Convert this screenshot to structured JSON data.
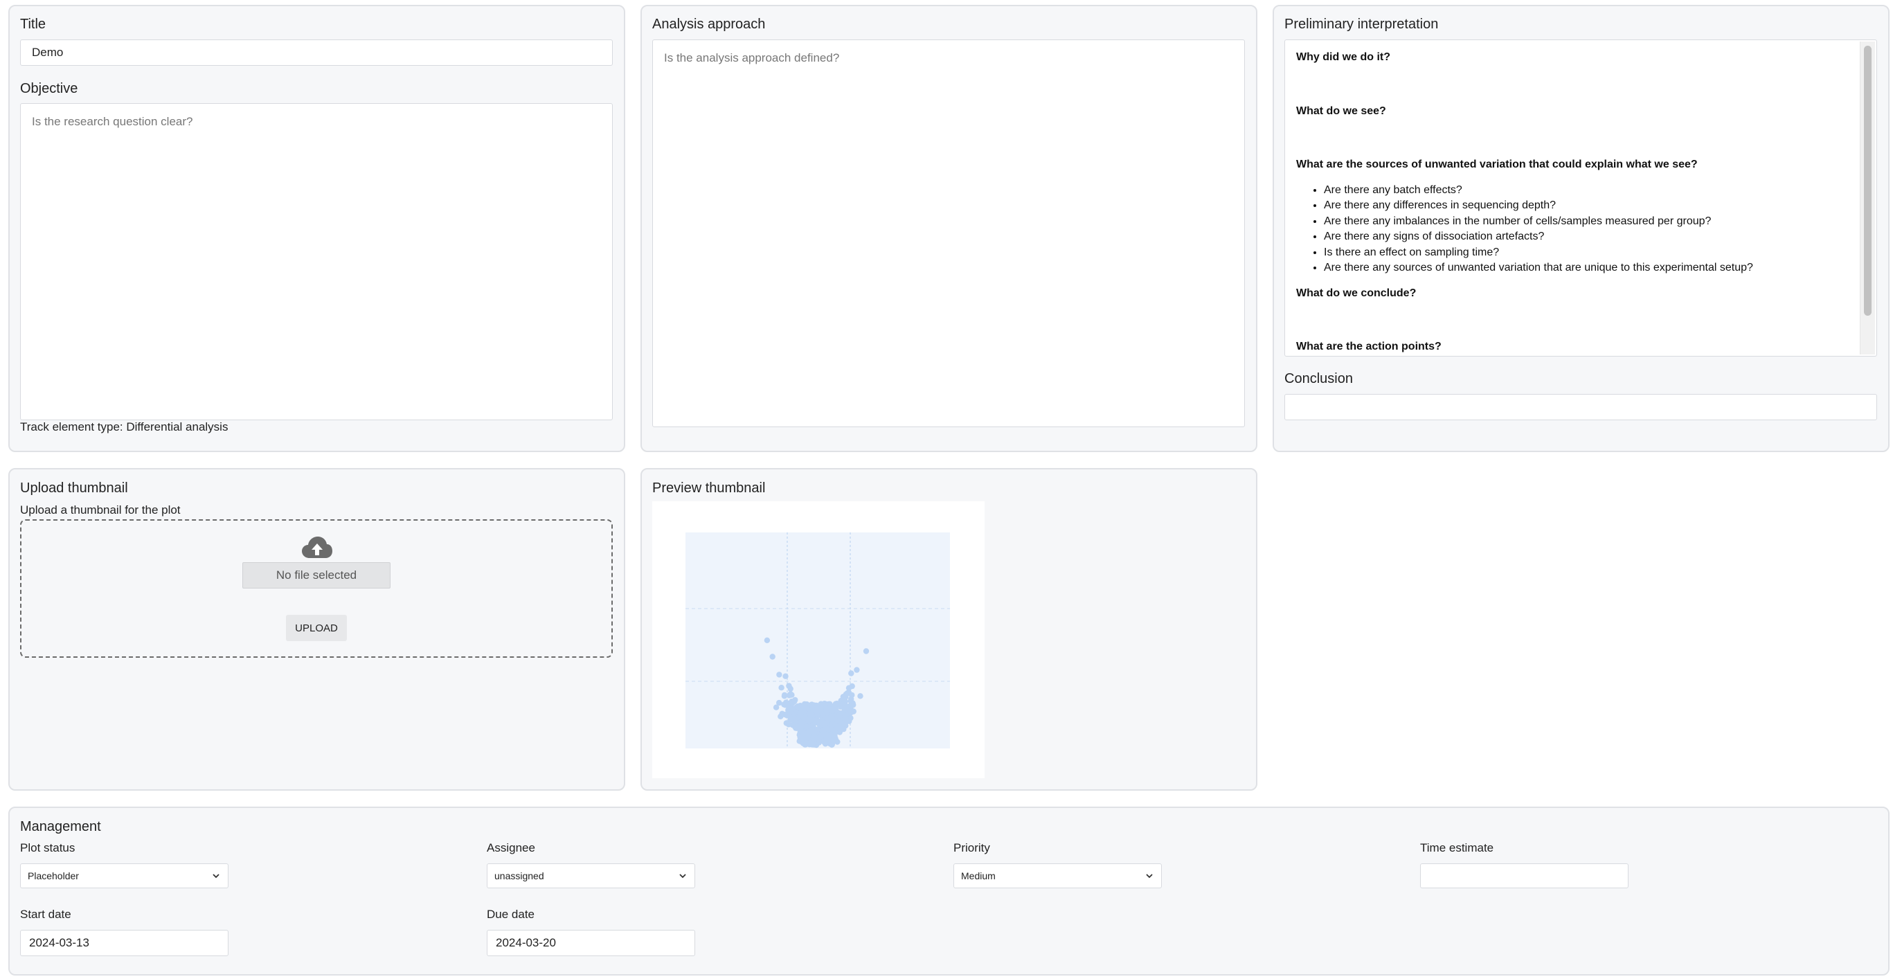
{
  "details": {
    "title_label": "Title",
    "title_value": "Demo",
    "objective_label": "Objective",
    "objective_placeholder": "Is the research question clear?",
    "track_type": "Track element type: Differential analysis"
  },
  "analysis": {
    "label": "Analysis approach",
    "placeholder": "Is the analysis approach defined?"
  },
  "interpretation": {
    "label": "Preliminary interpretation",
    "q1": "Why did we do it?",
    "q2": "What do we see?",
    "q3": "What are the sources of unwanted variation that could explain what we see?",
    "bullets": [
      "Are there any batch effects?",
      "Are there any differences in sequencing depth?",
      "Are there any imbalances in the number of cells/samples measured per group?",
      "Are there any signs of dissociation artefacts?",
      "Is there an effect on sampling time?",
      "Are there any sources of unwanted variation that are unique to this experimental setup?"
    ],
    "q4": "What do we conclude?",
    "q5": "What are the action points?",
    "conclusion_label": "Conclusion",
    "conclusion_value": ""
  },
  "upload": {
    "title": "Upload thumbnail",
    "subtitle": "Upload a thumbnail for the plot",
    "file_status": "No file selected",
    "button": "UPLOAD",
    "icon": "cloud-upload-icon"
  },
  "preview": {
    "title": "Preview thumbnail"
  },
  "management": {
    "title": "Management",
    "plot_status_label": "Plot status",
    "plot_status_value": "Placeholder",
    "assignee_label": "Assignee",
    "assignee_value": "unassigned",
    "priority_label": "Priority",
    "priority_value": "Medium",
    "time_estimate_label": "Time estimate",
    "time_estimate_value": "",
    "start_date_label": "Start date",
    "start_date_value": "2024-03-13",
    "due_date_label": "Due date",
    "due_date_value": "2024-03-20"
  },
  "colors": {
    "panel_bg": "#f6f7f9",
    "panel_border": "#dfe1e5",
    "thumb_point": "#b9d3f4",
    "thumb_bg": "#eef4fc"
  }
}
